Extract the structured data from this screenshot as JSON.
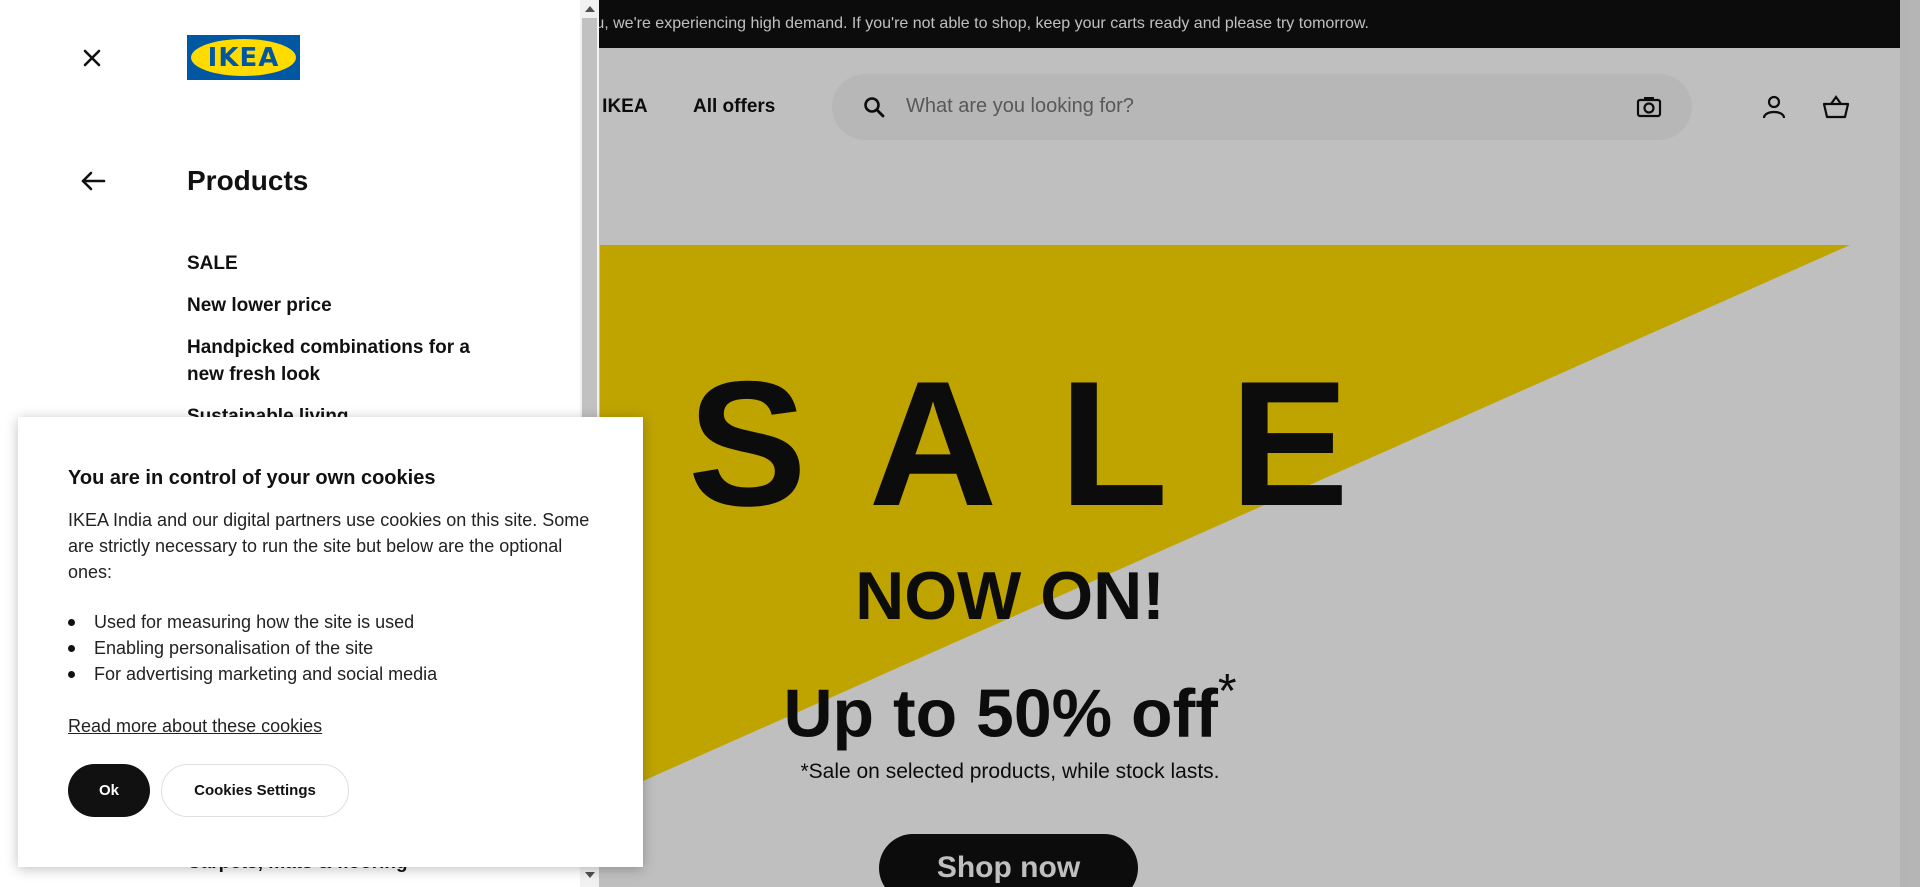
{
  "banner": {
    "text": "ru, we're experiencing high demand. If you're not able to shop, keep your carts ready and please try tomorrow."
  },
  "header": {
    "nav": [
      {
        "label": "at IKEA"
      },
      {
        "label": "All offers"
      }
    ],
    "search_placeholder": "What are you looking for?",
    "icons": [
      "search-icon",
      "camera-icon",
      "account-icon",
      "cart-icon"
    ]
  },
  "hero": {
    "sale": "SALE",
    "now_on": "NOW ON!",
    "discount": "Up to 50% off",
    "discount_mark": "*",
    "note": "*Sale on selected products, while stock lasts.",
    "cta": "Shop now",
    "accent_color": "#ffdb00"
  },
  "panel": {
    "logo": "IKEA",
    "title": "Products",
    "items": [
      {
        "label": "SALE"
      },
      {
        "label": "New lower price"
      },
      {
        "label": "Handpicked combinations for a new fresh look"
      },
      {
        "label": "Sustainable living"
      },
      {
        "label": "Carpets, mats & flooring"
      }
    ]
  },
  "cookie": {
    "title": "You are in control of your own cookies",
    "description": "IKEA India and our digital partners use cookies on this site. Some are strictly necessary to run the site but below are the optional ones:",
    "bullets": [
      "Used for measuring how the site is used",
      "Enabling personalisation of the site",
      "For advertising marketing and social media"
    ],
    "link": "Read more about these cookies",
    "ok_label": "Ok",
    "settings_label": "Cookies Settings"
  },
  "colors": {
    "brand_blue": "#0058a3",
    "brand_yellow": "#ffdb00"
  }
}
